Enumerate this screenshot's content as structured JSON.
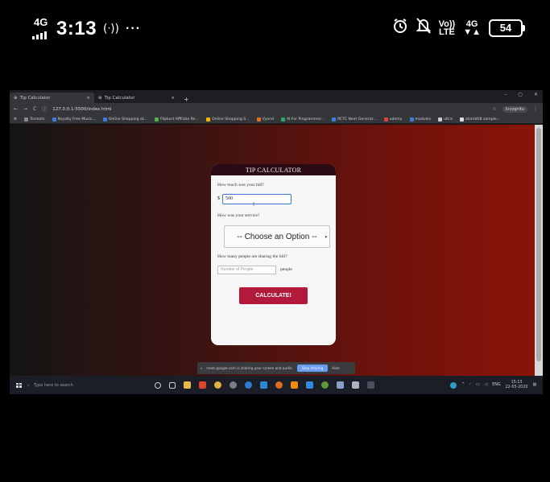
{
  "phone_status": {
    "network": "4G",
    "time": "3:13",
    "hotspot_icon": "(ᐧ))",
    "more": "···",
    "alarm_icon": "alarm-clock",
    "mute_icon": "bell-off",
    "volte_top": "Vo))",
    "volte_bottom": "LTE",
    "net2_top": "4G",
    "net2_bottom": "▼▲",
    "battery": "54"
  },
  "browser": {
    "tabs": [
      {
        "label": "Tip Calculator",
        "active": true
      },
      {
        "label": "Tip Calculator",
        "active": false
      }
    ],
    "new_tab": "+",
    "url": "127.0.0.1:5500/index.html",
    "profile": "Incognito",
    "bookmarks": [
      {
        "label": "Torrents",
        "color": "#888888"
      },
      {
        "label": "Royalty Free Music...",
        "color": "#3c7be0"
      },
      {
        "label": "Online Shopping at...",
        "color": "#3c7be0"
      },
      {
        "label": "Flipkart Affiliate Re...",
        "color": "#4caf50"
      },
      {
        "label": "Online Shopping S...",
        "color": "#f5b400"
      },
      {
        "label": "Vyond",
        "color": "#e07020"
      },
      {
        "label": "AI For Programmer...",
        "color": "#2ea86a"
      },
      {
        "label": "RCTC Next Generat...",
        "color": "#3c7be0"
      },
      {
        "label": "udemy",
        "color": "#e04040"
      },
      {
        "label": "modules",
        "color": "#3c7be0"
      },
      {
        "label": "ultra",
        "color": "#cccccc"
      },
      {
        "label": "ahmd4t8 sample...",
        "color": "#dddddd"
      }
    ]
  },
  "tip_calculator": {
    "title": "TIP CALCULATOR",
    "bill_question": "How much was your bill?",
    "currency": "$",
    "bill_value": "500",
    "service_question": "How was your service?",
    "service_selected": "-- Choose an Option --",
    "people_question": "How many people are sharing the bill?",
    "people_placeholder": "Number of People",
    "people_suffix": "people",
    "calculate_label": "CALCULATE!"
  },
  "share_banner": {
    "message": "meet.google.com is sharing your screen and audio.",
    "stop_label": "Stop sharing",
    "hide_label": "Hide"
  },
  "taskbar": {
    "search_placeholder": "Type here to search",
    "language": "ENG",
    "time": "15:13",
    "date": "22-05-2020"
  },
  "colors": {
    "card_header": "#2a0a14",
    "calculate_button": "#b3193a",
    "bill_focus_border": "#3c78d8"
  }
}
